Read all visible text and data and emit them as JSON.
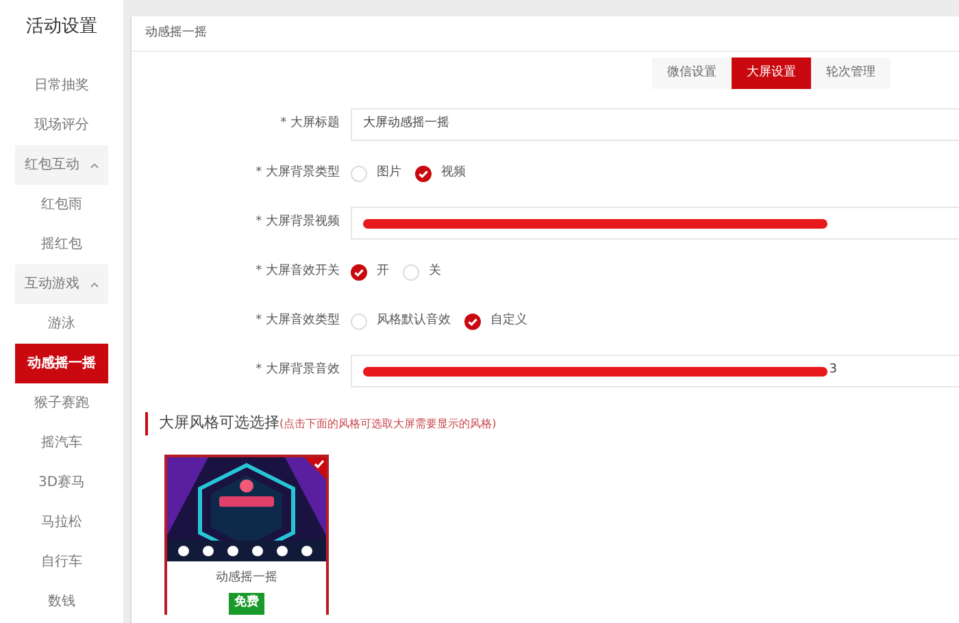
{
  "sidebar": {
    "title": "活动设置",
    "items": [
      {
        "label": "日常抽奖",
        "kind": "item",
        "selected": false
      },
      {
        "label": "现场评分",
        "kind": "item",
        "selected": false
      },
      {
        "label": "红包互动",
        "kind": "group",
        "expanded": true,
        "children": [
          {
            "label": "红包雨",
            "kind": "item",
            "selected": false
          },
          {
            "label": "摇红包",
            "kind": "item",
            "selected": false
          }
        ]
      },
      {
        "label": "互动游戏",
        "kind": "group",
        "expanded": true,
        "children": [
          {
            "label": "游泳",
            "kind": "item",
            "selected": false
          },
          {
            "label": "动感摇一摇",
            "kind": "item",
            "selected": true
          },
          {
            "label": "猴子赛跑",
            "kind": "item",
            "selected": false
          },
          {
            "label": "摇汽车",
            "kind": "item",
            "selected": false
          },
          {
            "label": "3D赛马",
            "kind": "item",
            "selected": false
          },
          {
            "label": "马拉松",
            "kind": "item",
            "selected": false
          },
          {
            "label": "自行车",
            "kind": "item",
            "selected": false
          },
          {
            "label": "数钱",
            "kind": "item",
            "selected": false
          }
        ]
      }
    ]
  },
  "panel": {
    "title": "动感摇一摇",
    "tabs": [
      {
        "label": "微信设置",
        "selected": false
      },
      {
        "label": "大屏设置",
        "selected": true
      },
      {
        "label": "轮次管理",
        "selected": false
      }
    ],
    "form": [
      {
        "label": "* 大屏标题",
        "kind": "text",
        "value": "大屏动感摇一摇"
      },
      {
        "label": "* 大屏背景类型",
        "kind": "radio",
        "options": [
          {
            "label": "图片",
            "selected": false
          },
          {
            "label": "视频",
            "selected": true
          }
        ]
      },
      {
        "label": "* 大屏背景视频",
        "kind": "redacted"
      },
      {
        "label": "* 大屏音效开关",
        "kind": "radio",
        "options": [
          {
            "label": "开",
            "selected": true
          },
          {
            "label": "关",
            "selected": false
          }
        ]
      },
      {
        "label": "* 大屏音效类型",
        "kind": "radio",
        "options": [
          {
            "label": "风格默认音效",
            "selected": false
          },
          {
            "label": "自定义",
            "selected": true
          }
        ]
      },
      {
        "label": "* 大屏背景音效",
        "kind": "redacted",
        "tail": "3"
      }
    ],
    "styles_section": {
      "title": "大屏风格可选选择",
      "hint": "(点击下面的风格可选取大屏需要显示的风格)"
    },
    "styles": [
      {
        "name": "动感摇一摇",
        "badge": "免费",
        "selected": true,
        "kind": "picture"
      }
    ]
  }
}
